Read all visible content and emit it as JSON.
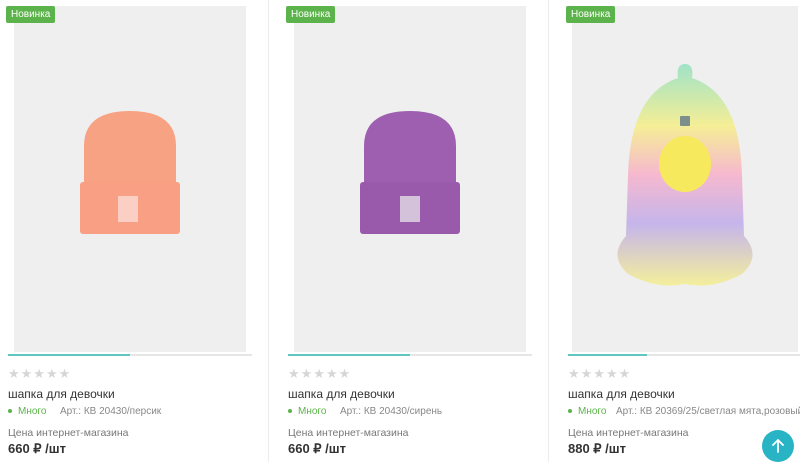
{
  "products": [
    {
      "badge": "Новинка",
      "image_icon": "peach-beanie-image",
      "rating_stars": "★★★★★",
      "name": "шапка для девочки",
      "stock": "Много",
      "article": "Арт.: КВ 20430/персик",
      "price_label": "Цена интернет-магазина",
      "price": "660 ₽ /шт",
      "color": "#f8a384"
    },
    {
      "badge": "Новинка",
      "image_icon": "lilac-beanie-image",
      "rating_stars": "★★★★★",
      "name": "шапка для девочки",
      "stock": "Много",
      "article": "Арт.: КВ 20430/сирень",
      "price_label": "Цена интернет-магазина",
      "price": "660 ₽ /шт",
      "color": "#9b5fae"
    },
    {
      "badge": "Новинка",
      "image_icon": "rainbow-balaclava-image",
      "rating_stars": "★★★★★",
      "name": "шапка для девочки",
      "stock": "Много",
      "article": "Арт.: КВ 20369/25/светлая мята,розовый",
      "price_label": "Цена интернет-магазина",
      "price": "880 ₽ /шт",
      "color": "#9fe0c8"
    }
  ],
  "scroll_top_icon": "arrow-up-icon",
  "colors": {
    "accent": "#5cb34b",
    "scroll_button": "#28b4c5",
    "slider": "#5fc6c1"
  }
}
